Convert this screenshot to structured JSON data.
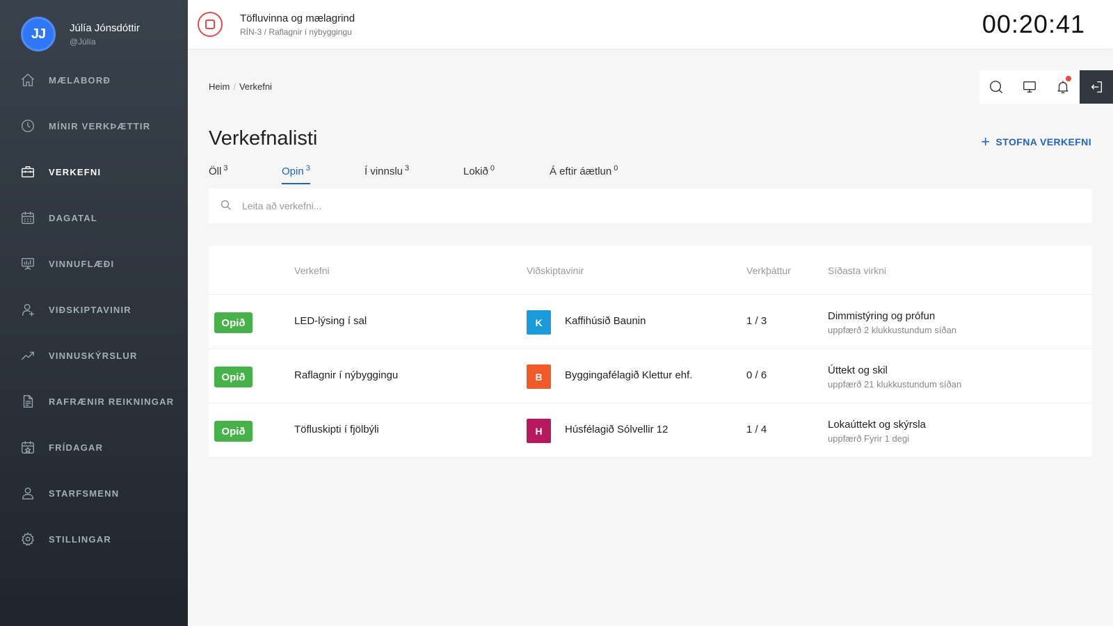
{
  "user": {
    "initials": "JJ",
    "name": "Júlía Jónsdóttir",
    "handle": "@Júlía"
  },
  "sidebar": {
    "items": [
      {
        "label": "MÆLABORÐ",
        "icon": "home-icon"
      },
      {
        "label": "MÍNIR VERKÞÆTTIR",
        "icon": "clock-icon"
      },
      {
        "label": "VERKEFNI",
        "icon": "briefcase-icon",
        "active": true
      },
      {
        "label": "DAGATAL",
        "icon": "calendar-icon"
      },
      {
        "label": "VINNUFLÆÐI",
        "icon": "presentation-board-icon"
      },
      {
        "label": "VIÐSKIPTAVINIR",
        "icon": "user-icon"
      },
      {
        "label": "VINNUSKÝRSLUR",
        "icon": "trend-chart-icon"
      },
      {
        "label": "RAFRÆNIR REIKNINGAR",
        "icon": "document-icon"
      },
      {
        "label": "FRÍDAGAR",
        "icon": "calendar-star-icon"
      },
      {
        "label": "STARFSMENN",
        "icon": "users-icon"
      },
      {
        "label": "STILLINGAR",
        "icon": "gear-icon"
      }
    ]
  },
  "topbar": {
    "task_title": "Töfluvinna og mælagrind",
    "task_sub": "RÍN-3 / Raflagnir í nýbyggingu",
    "timer": "00:20:41"
  },
  "breadcrumb": {
    "home": "Heim",
    "sep": "/",
    "current": "Verkefni"
  },
  "page": {
    "title": "Verkefnalisti",
    "create_label": "STOFNA VERKEFNI",
    "create_icon": "+"
  },
  "tabs": [
    {
      "label": "Öll",
      "count": "3"
    },
    {
      "label": "Opin",
      "count": "3",
      "active": true
    },
    {
      "label": "Í vinnslu",
      "count": "3"
    },
    {
      "label": "Lokið",
      "count": "0"
    },
    {
      "label": "Á eftir áætlun",
      "count": "0"
    }
  ],
  "search": {
    "placeholder": "Leita að verkefni..."
  },
  "table": {
    "headers": {
      "project": "Verkefni",
      "client": "Viðskiptavinir",
      "phase": "Verkþáttur",
      "activity": "Síðasta virkni"
    },
    "rows": [
      {
        "status": "Opið",
        "project": "LED-lýsing í sal",
        "client_initial": "K",
        "client_color": "#1a9ad9",
        "client": "Kaffihúsið Baunin",
        "phase": "1 / 3",
        "activity": "Dimmistýring og prófun",
        "updated": "uppfærð 2 klukkustundum síðan"
      },
      {
        "status": "Opið",
        "project": "Raflagnir í nýbyggingu",
        "client_initial": "B",
        "client_color": "#ef5a28",
        "client": "Byggingafélagið Klettur ehf.",
        "phase": "0 / 6",
        "activity": "Úttekt og skil",
        "updated": "uppfærð 21 klukkustundum síðan"
      },
      {
        "status": "Opið",
        "project": "Töfluskipti í fjölbýli",
        "client_initial": "H",
        "client_color": "#b5195e",
        "client": "Húsfélagið Sólvellir 12",
        "phase": "1 / 4",
        "activity": "Lokaúttekt og skýrsla",
        "updated": "uppfærð Fyrir 1 degi"
      }
    ]
  },
  "colors": {
    "accent": "#2463b8",
    "status_open": "#47b14a",
    "stop": "#e24a4a",
    "notification": "#e74c3c"
  }
}
